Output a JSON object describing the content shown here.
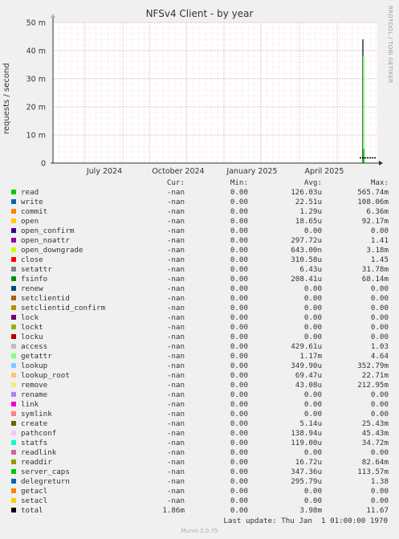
{
  "chart_data": {
    "type": "line",
    "title": "NFSv4 Client - by year",
    "ylabel": "requests / second",
    "y_unit": "m",
    "ylim": [
      0,
      50
    ],
    "y_ticks": [
      {
        "value": 0,
        "label": "0"
      },
      {
        "value": 10,
        "label": "10 m"
      },
      {
        "value": 20,
        "label": "20 m"
      },
      {
        "value": 30,
        "label": "30 m"
      },
      {
        "value": 40,
        "label": "40 m"
      },
      {
        "value": 50,
        "label": "50 m"
      }
    ],
    "x_ticks": [
      "July 2024",
      "October 2024",
      "January 2025",
      "April 2025"
    ],
    "grid": true,
    "legend_position": "bottom",
    "spikes": [
      {
        "series": "total",
        "peak": 44,
        "baseline": 1.86
      },
      {
        "series": "getattr",
        "peak": 38
      },
      {
        "series": "read",
        "peak": 5
      }
    ]
  },
  "side_credit": "RRDTOOL / TOBI OETIKER",
  "legend": {
    "headers": {
      "cur": "Cur:",
      "min": "Min:",
      "avg": "Avg:",
      "max": "Max:"
    },
    "series": [
      {
        "name": "read",
        "color": "#00cc00",
        "cur": "-nan",
        "min": "0.00",
        "avg": "126.03u",
        "max": "565.74m"
      },
      {
        "name": "write",
        "color": "#0066b3",
        "cur": "-nan",
        "min": "0.00",
        "avg": "22.51u",
        "max": "108.06m"
      },
      {
        "name": "commit",
        "color": "#ff8000",
        "cur": "-nan",
        "min": "0.00",
        "avg": "1.29u",
        "max": "6.36m"
      },
      {
        "name": "open",
        "color": "#ffcc00",
        "cur": "-nan",
        "min": "0.00",
        "avg": "18.65u",
        "max": "92.17m"
      },
      {
        "name": "open_confirm",
        "color": "#330099",
        "cur": "-nan",
        "min": "0.00",
        "avg": "0.00",
        "max": "0.00"
      },
      {
        "name": "open_noattr",
        "color": "#990099",
        "cur": "-nan",
        "min": "0.00",
        "avg": "297.72u",
        "max": "1.41"
      },
      {
        "name": "open_downgrade",
        "color": "#ccff00",
        "cur": "-nan",
        "min": "0.00",
        "avg": "643.00n",
        "max": "3.18m"
      },
      {
        "name": "close",
        "color": "#ff0000",
        "cur": "-nan",
        "min": "0.00",
        "avg": "310.58u",
        "max": "1.45"
      },
      {
        "name": "setattr",
        "color": "#808080",
        "cur": "-nan",
        "min": "0.00",
        "avg": "6.43u",
        "max": "31.78m"
      },
      {
        "name": "fsinfo",
        "color": "#008f00",
        "cur": "-nan",
        "min": "0.00",
        "avg": "208.41u",
        "max": "68.14m"
      },
      {
        "name": "renew",
        "color": "#00487d",
        "cur": "-nan",
        "min": "0.00",
        "avg": "0.00",
        "max": "0.00"
      },
      {
        "name": "setclientid",
        "color": "#b35a00",
        "cur": "-nan",
        "min": "0.00",
        "avg": "0.00",
        "max": "0.00"
      },
      {
        "name": "setclientid_confirm",
        "color": "#b38f00",
        "cur": "-nan",
        "min": "0.00",
        "avg": "0.00",
        "max": "0.00"
      },
      {
        "name": "lock",
        "color": "#6b006b",
        "cur": "-nan",
        "min": "0.00",
        "avg": "0.00",
        "max": "0.00"
      },
      {
        "name": "lockt",
        "color": "#8fb300",
        "cur": "-nan",
        "min": "0.00",
        "avg": "0.00",
        "max": "0.00"
      },
      {
        "name": "locku",
        "color": "#b30000",
        "cur": "-nan",
        "min": "0.00",
        "avg": "0.00",
        "max": "0.00"
      },
      {
        "name": "access",
        "color": "#bebebe",
        "cur": "-nan",
        "min": "0.00",
        "avg": "429.61u",
        "max": "1.03"
      },
      {
        "name": "getattr",
        "color": "#80ff80",
        "cur": "-nan",
        "min": "0.00",
        "avg": "1.17m",
        "max": "4.64"
      },
      {
        "name": "lookup",
        "color": "#80c9ff",
        "cur": "-nan",
        "min": "0.00",
        "avg": "349.90u",
        "max": "352.79m"
      },
      {
        "name": "lookup_root",
        "color": "#ffc080",
        "cur": "-nan",
        "min": "0.00",
        "avg": "69.47u",
        "max": "22.71m"
      },
      {
        "name": "remove",
        "color": "#ffe680",
        "cur": "-nan",
        "min": "0.00",
        "avg": "43.08u",
        "max": "212.95m"
      },
      {
        "name": "rename",
        "color": "#aa80ff",
        "cur": "-nan",
        "min": "0.00",
        "avg": "0.00",
        "max": "0.00"
      },
      {
        "name": "link",
        "color": "#ee00cc",
        "cur": "-nan",
        "min": "0.00",
        "avg": "0.00",
        "max": "0.00"
      },
      {
        "name": "symlink",
        "color": "#ff8080",
        "cur": "-nan",
        "min": "0.00",
        "avg": "0.00",
        "max": "0.00"
      },
      {
        "name": "create",
        "color": "#666600",
        "cur": "-nan",
        "min": "0.00",
        "avg": "5.14u",
        "max": "25.43m"
      },
      {
        "name": "pathconf",
        "color": "#ffbfff",
        "cur": "-nan",
        "min": "0.00",
        "avg": "138.94u",
        "max": "45.43m"
      },
      {
        "name": "statfs",
        "color": "#00ffcc",
        "cur": "-nan",
        "min": "0.00",
        "avg": "119.00u",
        "max": "34.72m"
      },
      {
        "name": "readlink",
        "color": "#cc6699",
        "cur": "-nan",
        "min": "0.00",
        "avg": "0.00",
        "max": "0.00"
      },
      {
        "name": "readdir",
        "color": "#999900",
        "cur": "-nan",
        "min": "0.00",
        "avg": "16.72u",
        "max": "82.64m"
      },
      {
        "name": "server_caps",
        "color": "#00cc00",
        "cur": "-nan",
        "min": "0.00",
        "avg": "347.36u",
        "max": "113.57m"
      },
      {
        "name": "delegreturn",
        "color": "#0066b3",
        "cur": "-nan",
        "min": "0.00",
        "avg": "295.79u",
        "max": "1.38"
      },
      {
        "name": "getacl",
        "color": "#ff8000",
        "cur": "-nan",
        "min": "0.00",
        "avg": "0.00",
        "max": "0.00"
      },
      {
        "name": "setacl",
        "color": "#ffcc00",
        "cur": "-nan",
        "min": "0.00",
        "avg": "0.00",
        "max": "0.00"
      },
      {
        "name": "total",
        "color": "#000000",
        "cur": "1.86m",
        "min": "0.00",
        "avg": "3.98m",
        "max": "11.67"
      }
    ]
  },
  "last_update": "Last update: Thu Jan  1 01:00:00 1970",
  "footer": "Munin 2.0.75"
}
